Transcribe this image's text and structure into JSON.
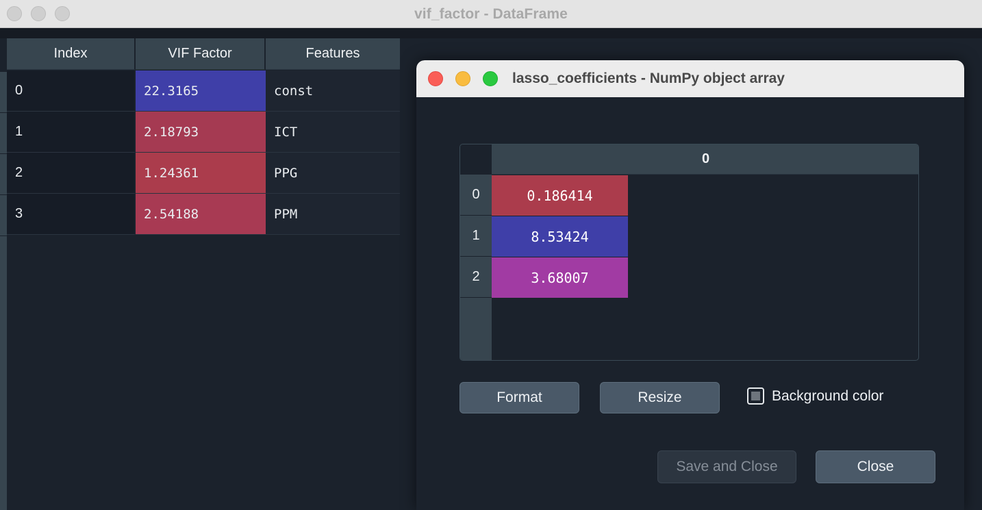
{
  "main_window": {
    "title": "vif_factor - DataFrame",
    "traffic_lights": [
      "close-icon",
      "minimize-icon",
      "zoom-icon"
    ],
    "table": {
      "columns": [
        "Index",
        "VIF Factor",
        "Features"
      ],
      "rows": [
        {
          "index": "0",
          "vif_factor": "22.3165",
          "features": "const",
          "color": "#3f3fa8"
        },
        {
          "index": "1",
          "vif_factor": "2.18793",
          "features": "ICT",
          "color": "#a53a52"
        },
        {
          "index": "2",
          "vif_factor": "1.24361",
          "features": "PPG",
          "color": "#ab3c4c"
        },
        {
          "index": "3",
          "vif_factor": "2.54188",
          "features": "PPM",
          "color": "#a83a53"
        }
      ]
    }
  },
  "dialog": {
    "title": "lasso_coefficients - NumPy object array",
    "traffic_lights": [
      "close-icon",
      "minimize-icon",
      "zoom-icon"
    ],
    "array": {
      "column_header": "0",
      "rows": [
        {
          "index": "0",
          "value": "0.186414",
          "color": "#ab3c4c"
        },
        {
          "index": "1",
          "value": "8.53424",
          "color": "#3f3fa8"
        },
        {
          "index": "2",
          "value": "3.68007",
          "color": "#a13ba3"
        }
      ]
    },
    "buttons": {
      "format": "Format",
      "resize": "Resize",
      "save_and_close": "Save and Close",
      "close": "Close"
    },
    "background_color_label": "Background color"
  },
  "colors": {
    "window_bg": "#1b222c",
    "header_bg": "#37454f",
    "titlebar_bg": "#e4e4e4",
    "dialog_titlebar_bg": "#ececec",
    "blue": "#3f3fa8",
    "red": "#a53a52",
    "magenta": "#a13ba3",
    "button_bg": "#4a5968"
  }
}
